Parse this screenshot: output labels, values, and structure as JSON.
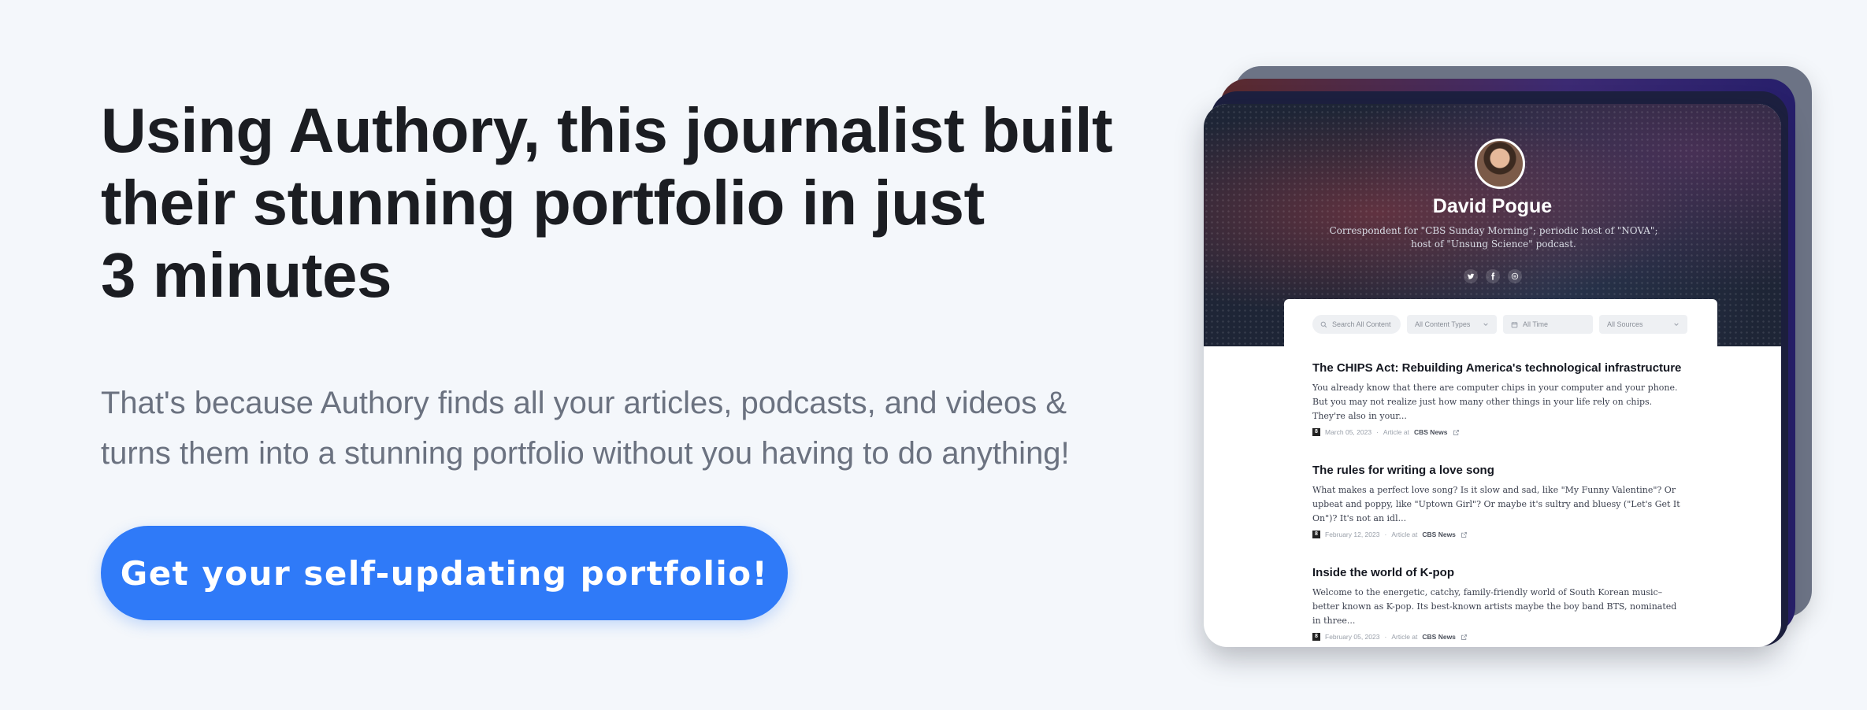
{
  "headline": [
    "Using Authory, this journalist built",
    "their stunning portfolio in just",
    "3 minutes"
  ],
  "subtext": [
    "That's because Authory finds all your articles, podcasts, and videos &",
    "turns them into a stunning portfolio without you having to do anything!"
  ],
  "cta": "Get your self-updating portfolio!",
  "colors": {
    "accent": "#2f7af8",
    "background": "#f4f7fb",
    "headline": "#1b1d22",
    "subtext": "#6b7280"
  },
  "profile": {
    "name": "David Pogue",
    "bio": "Correspondent for \"CBS Sunday Morning\"; periodic host of \"NOVA\"; host of \"Unsung Science\" podcast.",
    "socials": [
      "twitter-icon",
      "facebook-icon",
      "podcast-icon"
    ]
  },
  "filters": {
    "search_placeholder": "Search All Content",
    "content_types": "All Content Types",
    "time": "All Time",
    "sources": "All Sources"
  },
  "articles": [
    {
      "title": "The CHIPS Act: Rebuilding America's technological infrastructure",
      "excerpt": "You already know that there are computer chips in your computer and your phone. But you may not realize just how many other things in your life rely on chips. They're also in your...",
      "date": "March 05, 2023",
      "type": "Article at",
      "source": "CBS News"
    },
    {
      "title": "The rules for writing a love song",
      "excerpt": "What makes a perfect love song? Is it slow and sad, like \"My Funny Valentine\"? Or upbeat and poppy, like \"Uptown Girl\"? Or maybe it's sultry and bluesy (\"Let's Get It On\")? It's not an idl...",
      "date": "February 12, 2023",
      "type": "Article at",
      "source": "CBS News"
    },
    {
      "title": "Inside the world of K-pop",
      "excerpt": "Welcome to the energetic, catchy, family-friendly world of South Korean music–better known as K-pop. Its best-known artists maybe the boy band BTS, nominated in three...",
      "date": "February 05, 2023",
      "type": "Article at",
      "source": "CBS News"
    }
  ],
  "separator": "·",
  "source_badge": "8"
}
